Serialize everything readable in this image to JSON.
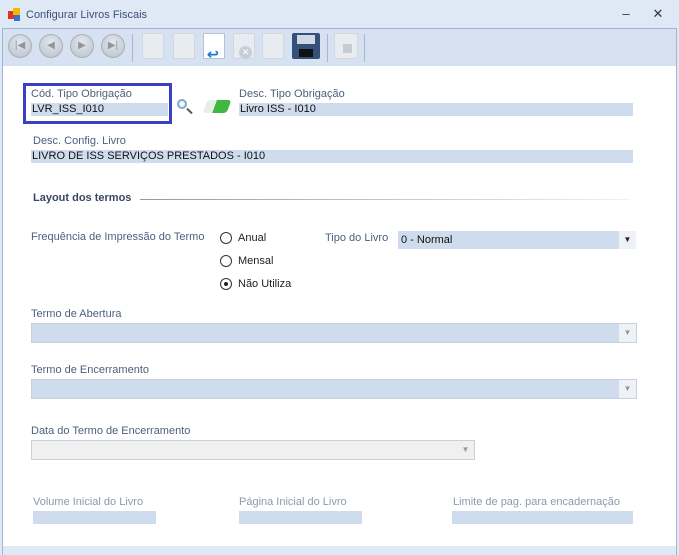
{
  "window": {
    "title": "Configurar Livros Fiscais",
    "minimize": "–",
    "close": "✕"
  },
  "toolbar": {
    "buttons": [
      "first-icon",
      "previous-icon",
      "next-icon",
      "last-icon",
      "new-icon",
      "edit-icon",
      "undo-icon",
      "delete-icon",
      "redo-icon",
      "save-icon",
      "lock-icon"
    ]
  },
  "form": {
    "cod_tipo_label": "Cód. Tipo Obrigação",
    "cod_tipo_value": "LVR_ISS_I010",
    "desc_tipo_label": "Desc. Tipo Obrigação",
    "desc_tipo_value": "Livro ISS - I010",
    "desc_config_label": "Desc. Config. Livro",
    "desc_config_value": "LIVRO DE ISS SERVIÇOS PRESTADOS - I010",
    "section_title": "Layout dos termos",
    "freq_label": "Frequência de Impressão do Termo",
    "freq_options": [
      "Anual",
      "Mensal",
      "Não Utiliza"
    ],
    "freq_selected": "Não Utiliza",
    "tipo_livro_label": "Tipo do Livro",
    "tipo_livro_value": "0 - Normal",
    "termo_abertura_label": "Termo de Abertura",
    "termo_encerramento_label": "Termo de Encerramento",
    "data_termo_label": "Data do Termo de Encerramento",
    "volume_label": "Volume Inicial do Livro",
    "pagina_label": "Página Inicial do Livro",
    "limite_label": "Limite de pag. para encadernação"
  },
  "colors": {
    "highlight_border": "#3a3fc4",
    "field_bg": "#cfdcee"
  }
}
